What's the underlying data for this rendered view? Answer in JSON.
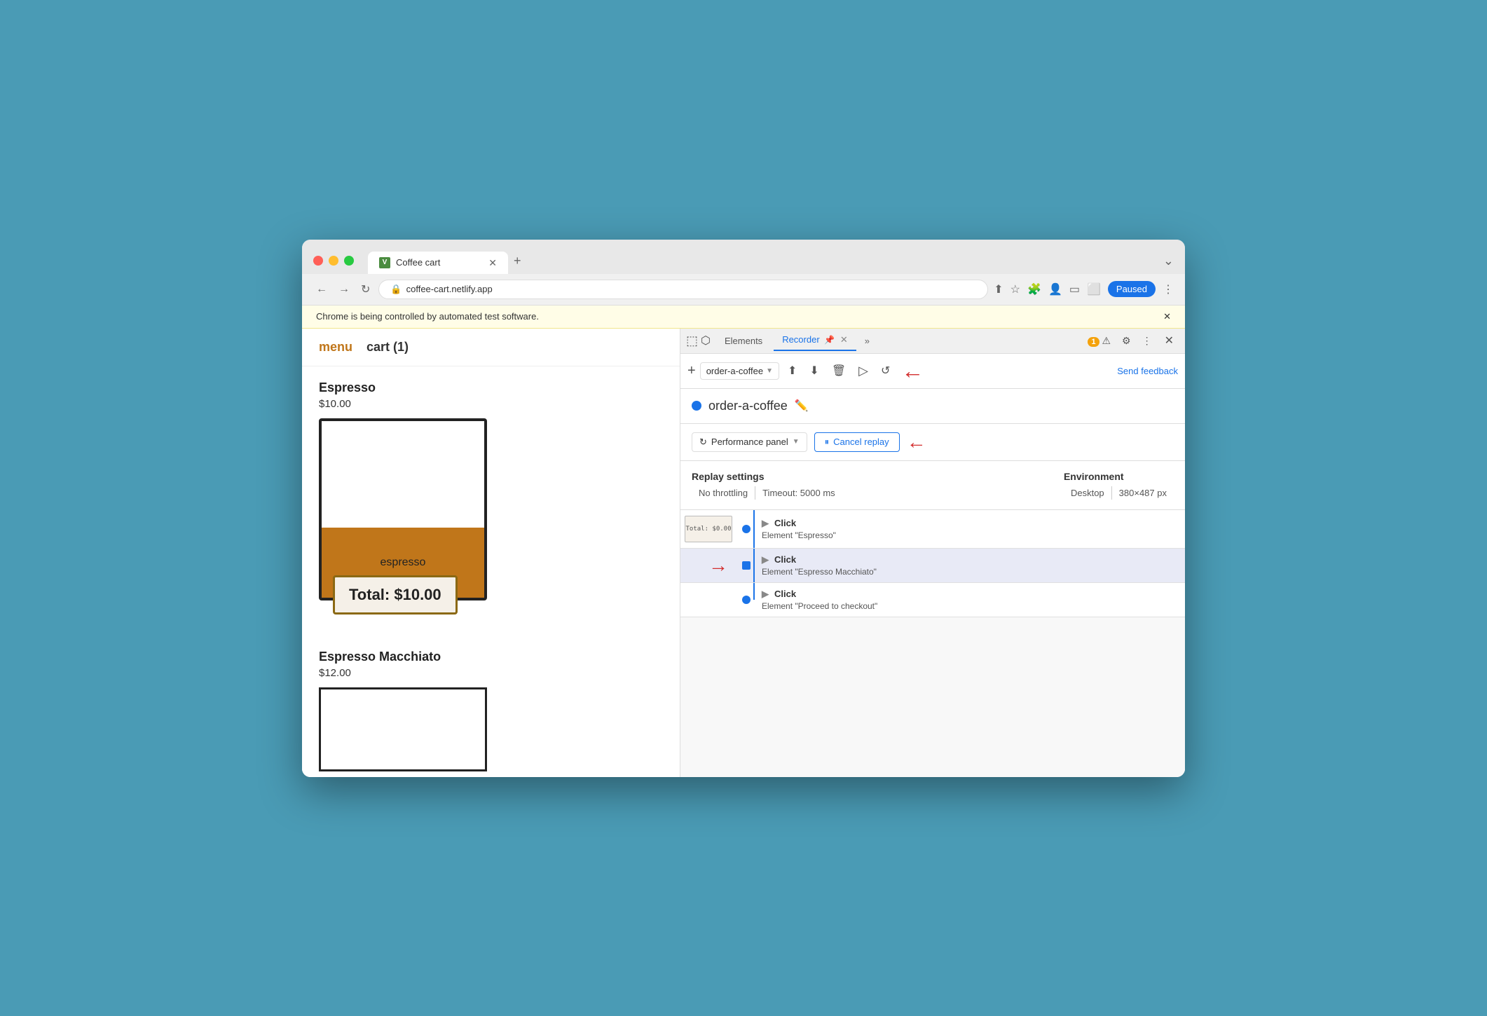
{
  "browser": {
    "tab_title": "Coffee cart",
    "tab_favicon": "V",
    "url": "coffee-cart.netlify.app",
    "paused_label": "Paused",
    "new_tab_label": "+",
    "automation_notice": "Chrome is being controlled by automated test software."
  },
  "website": {
    "nav_menu": "menu",
    "nav_cart": "cart (1)",
    "products": [
      {
        "name": "Espresso",
        "price": "$10.00",
        "coffee_label": "espresso"
      },
      {
        "name": "Espresso Macchiato",
        "price": "$12.00"
      }
    ],
    "total_popup": "Total: $10.00"
  },
  "devtools": {
    "tabs": [
      {
        "label": "Elements",
        "active": false
      },
      {
        "label": "Recorder",
        "active": true
      },
      {
        "label": "»",
        "active": false
      }
    ],
    "recorder_tab_pin_icon": "📌",
    "close_icon": "✕",
    "badge_count": "1",
    "toolbar": {
      "add_icon": "+",
      "recording_name": "order-a-coffee",
      "send_feedback": "Send feedback"
    },
    "recording": {
      "name": "order-a-coffee",
      "edit_icon": "✏️"
    },
    "replay": {
      "performance_panel_label": "Performance panel",
      "cancel_replay_label": "Cancel replay",
      "pause_icon": "⏸"
    },
    "settings": {
      "replay_settings_label": "Replay settings",
      "no_throttling": "No throttling",
      "timeout": "Timeout: 5000 ms",
      "environment_label": "Environment",
      "desktop": "Desktop",
      "resolution": "380×487 px"
    },
    "steps": [
      {
        "has_screenshot": true,
        "screenshot_text": "Total: $0.00",
        "action": "Click",
        "detail": "Element \"Espresso\"",
        "active": false,
        "has_arrow": false,
        "dot_type": "circle"
      },
      {
        "has_screenshot": false,
        "action": "Click",
        "detail": "Element \"Espresso Macchiato\"",
        "active": true,
        "has_arrow": true,
        "dot_type": "square"
      },
      {
        "has_screenshot": false,
        "action": "Click",
        "detail": "Element \"Proceed to checkout\"",
        "active": false,
        "has_arrow": false,
        "dot_type": "circle"
      }
    ]
  }
}
